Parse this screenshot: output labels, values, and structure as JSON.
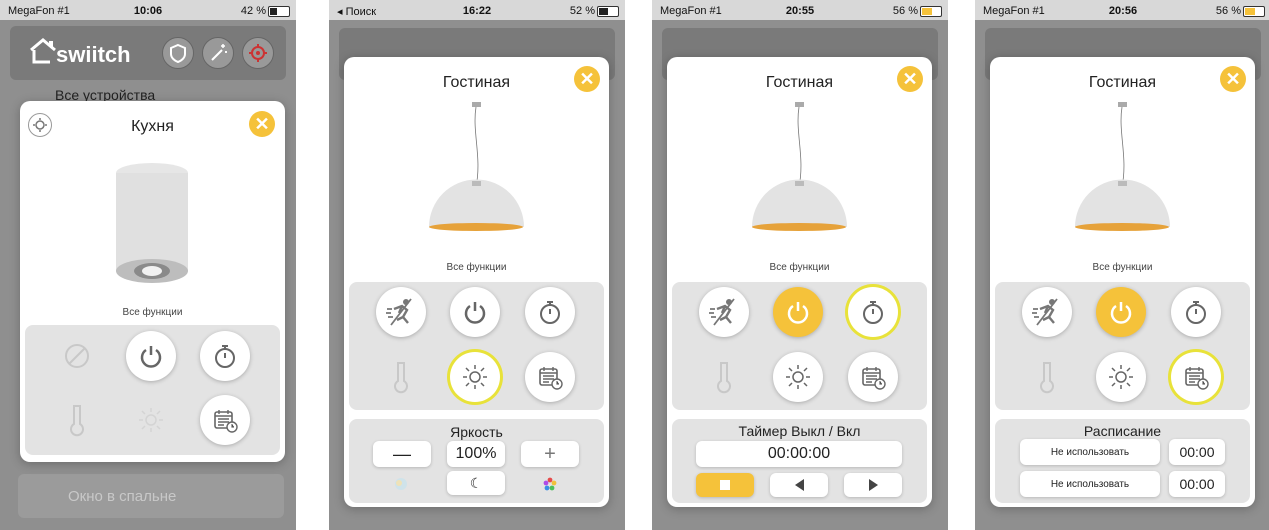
{
  "phones": [
    {
      "status": {
        "carrier": "MegaFon #1",
        "time": "10:06",
        "battery": "42 %"
      },
      "app_title": "swiitch",
      "bg_list_top": "Все устройства",
      "bg_list_bottom": "Окно в спальне",
      "card_title": "Кухня",
      "all_functions": "Все функции"
    },
    {
      "status": {
        "carrier": "◂ Поиск",
        "time": "16:22",
        "battery": "52 %"
      },
      "card_title": "Гостиная",
      "all_functions": "Все функции",
      "section_title": "Яркость",
      "minus": "—",
      "value": "100%",
      "plus": "+"
    },
    {
      "status": {
        "carrier": "MegaFon #1",
        "time": "20:55",
        "battery": "56 %"
      },
      "card_title": "Гостиная",
      "all_functions": "Все функции",
      "section_title": "Таймер Выкл / Вкл",
      "timer_value": "00:00:00"
    },
    {
      "status": {
        "carrier": "MegaFon #1",
        "time": "20:56",
        "battery": "56 %"
      },
      "card_title": "Гостиная",
      "all_functions": "Все функции",
      "section_title": "Расписание",
      "rows": [
        {
          "label": "Не использовать",
          "time": "00:00"
        },
        {
          "label": "Не использовать",
          "time": "00:00"
        }
      ]
    }
  ],
  "colors": {
    "accent": "#f5c23a",
    "ring": "#e8e23a"
  }
}
